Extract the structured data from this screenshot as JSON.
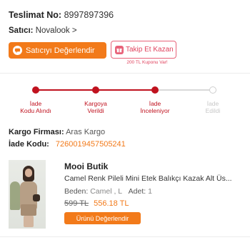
{
  "order": {
    "delivery_label": "Teslimat No:",
    "delivery_number": "8997897396",
    "seller_label": "Satıcı:",
    "seller_name": "Novalook",
    "seller_chevron": ">"
  },
  "actions": {
    "rate_seller": "Satıcıyı Değerlendir",
    "follow_win": "Takip Et Kazan",
    "coupon_note": "200 TL Kuponu Var!"
  },
  "tracking": {
    "steps": [
      {
        "label": "İade Kodu Alındı",
        "line1": "İade",
        "line2": "Kodu Alındı",
        "active": true
      },
      {
        "label": "Kargoya Verildi",
        "line1": "Kargoya",
        "line2": "Verildi",
        "active": true
      },
      {
        "label": "İade İnceleniyor",
        "line1": "İade",
        "line2": "İnceleniyor",
        "active": true
      },
      {
        "label": "İade Edildi",
        "line1": "İade",
        "line2": "Edildi",
        "active": false
      }
    ]
  },
  "shipping": {
    "company_label": "Kargo Firması:",
    "company_name": "Aras Kargo",
    "code_label": "İade Kodu:",
    "code_value": "7260019457505241"
  },
  "product": {
    "brand": "Mooi Butik",
    "name": "Camel Renk Pileli Mini Etek Balıkçı Kazak Alt Üs...",
    "variant_label": "Beden:",
    "variant_value": "Camel , L",
    "quantity_label": "Adet:",
    "quantity_value": "1",
    "old_price": "599 TL",
    "new_price": "556.18 TL",
    "rate_button": "Ürünü Değerlendir"
  },
  "colors": {
    "accent": "#f27a1a",
    "tracking_red": "#c0121f",
    "follow_pink": "#e0435e"
  }
}
